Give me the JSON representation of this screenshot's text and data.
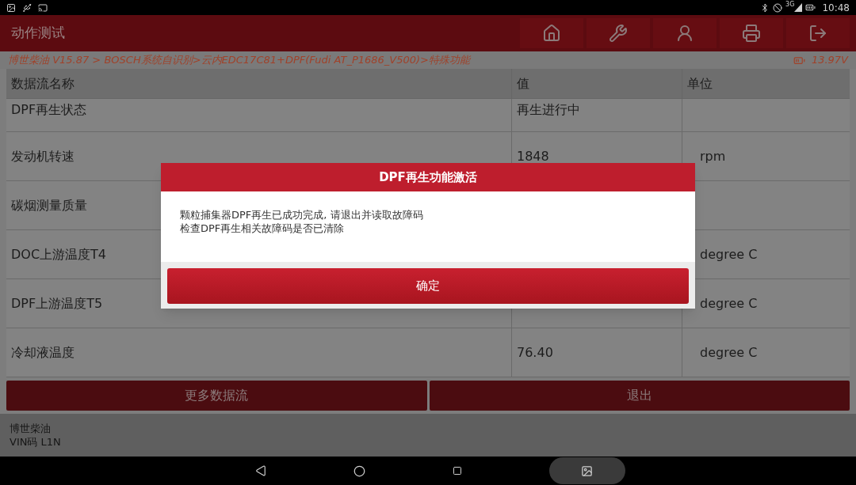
{
  "status_bar": {
    "network_type": "3G",
    "time": "10:48"
  },
  "header": {
    "title": "动作测试"
  },
  "breadcrumb": {
    "path": "博世柴油 V15.87 > BOSCH系统自识别>云内EDC17C81+DPF(Fudi AT_P1686_V500)>特殊功能",
    "voltage": "13.97V"
  },
  "table": {
    "columns": [
      "数据流名称",
      "值",
      "单位"
    ],
    "rows": [
      {
        "name": "DPF再生状态",
        "value": "再生进行中",
        "unit": ""
      },
      {
        "name": "发动机转速",
        "value": "1848",
        "unit": "rpm"
      },
      {
        "name": "碳烟测量质量",
        "value": "",
        "unit": ""
      },
      {
        "name": "DOC上游温度T4",
        "value": "",
        "unit": "degree C"
      },
      {
        "name": "DPF上游温度T5",
        "value": "",
        "unit": "degree C"
      },
      {
        "name": "冷却液温度",
        "value": "76.40",
        "unit": "degree C"
      }
    ]
  },
  "actions": [
    "更多数据流",
    "退出"
  ],
  "footer": {
    "make": "博世柴油",
    "vin": "VIN码 L1N"
  },
  "dialog": {
    "title": "DPF再生功能激活",
    "lines": [
      "颗粒捕集器DPF再生已成功完成, 请退出并读取故障码",
      "检查DPF再生相关故障码是否已清除"
    ],
    "button": "确定"
  }
}
